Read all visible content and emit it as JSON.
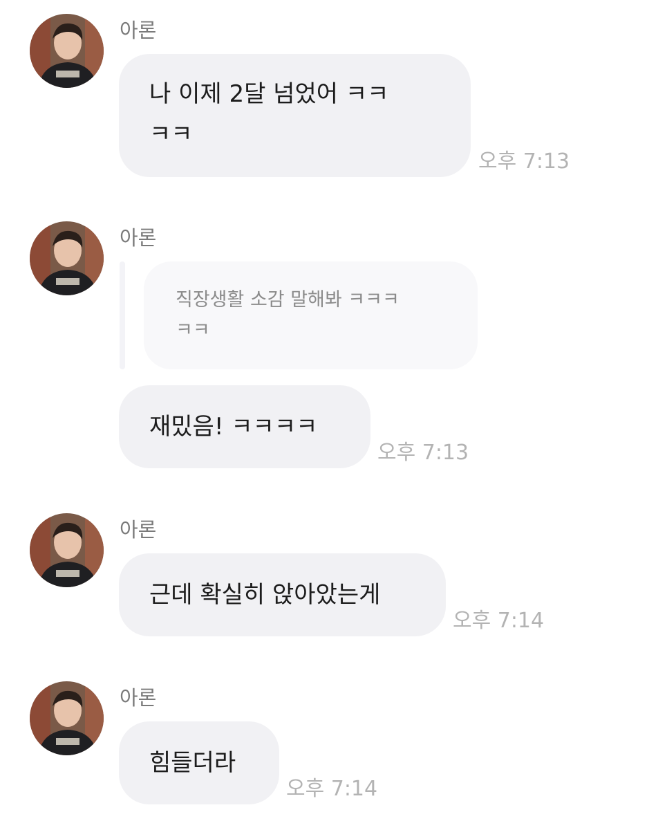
{
  "colors": {
    "bubble_bg": "#f1f1f4",
    "reply_bg": "#f8f8fa",
    "name_text": "#7a7a7a",
    "time_text": "#b3b3b3",
    "message_text": "#1c1c1c"
  },
  "messages": [
    {
      "sender": "아론",
      "avatar": "profile-photo",
      "lines": [
        "나 이제 2달 넘었어 ㅋㅋ",
        "ㅋㅋ"
      ],
      "time": "오후 7:13"
    },
    {
      "sender": "아론",
      "avatar": "profile-photo",
      "reply_lines": [
        "직장생활 소감 말해봐 ㅋㅋㅋ",
        "ㅋㅋ"
      ],
      "lines": [
        "재밌음! ㅋㅋㅋㅋ"
      ],
      "time": "오후 7:13"
    },
    {
      "sender": "아론",
      "avatar": "profile-photo",
      "lines": [
        "근데 확실히 앉아았는게"
      ],
      "time": "오후 7:14"
    },
    {
      "sender": "아론",
      "avatar": "profile-photo",
      "lines": [
        "힘들더라"
      ],
      "time": "오후 7:14"
    }
  ]
}
